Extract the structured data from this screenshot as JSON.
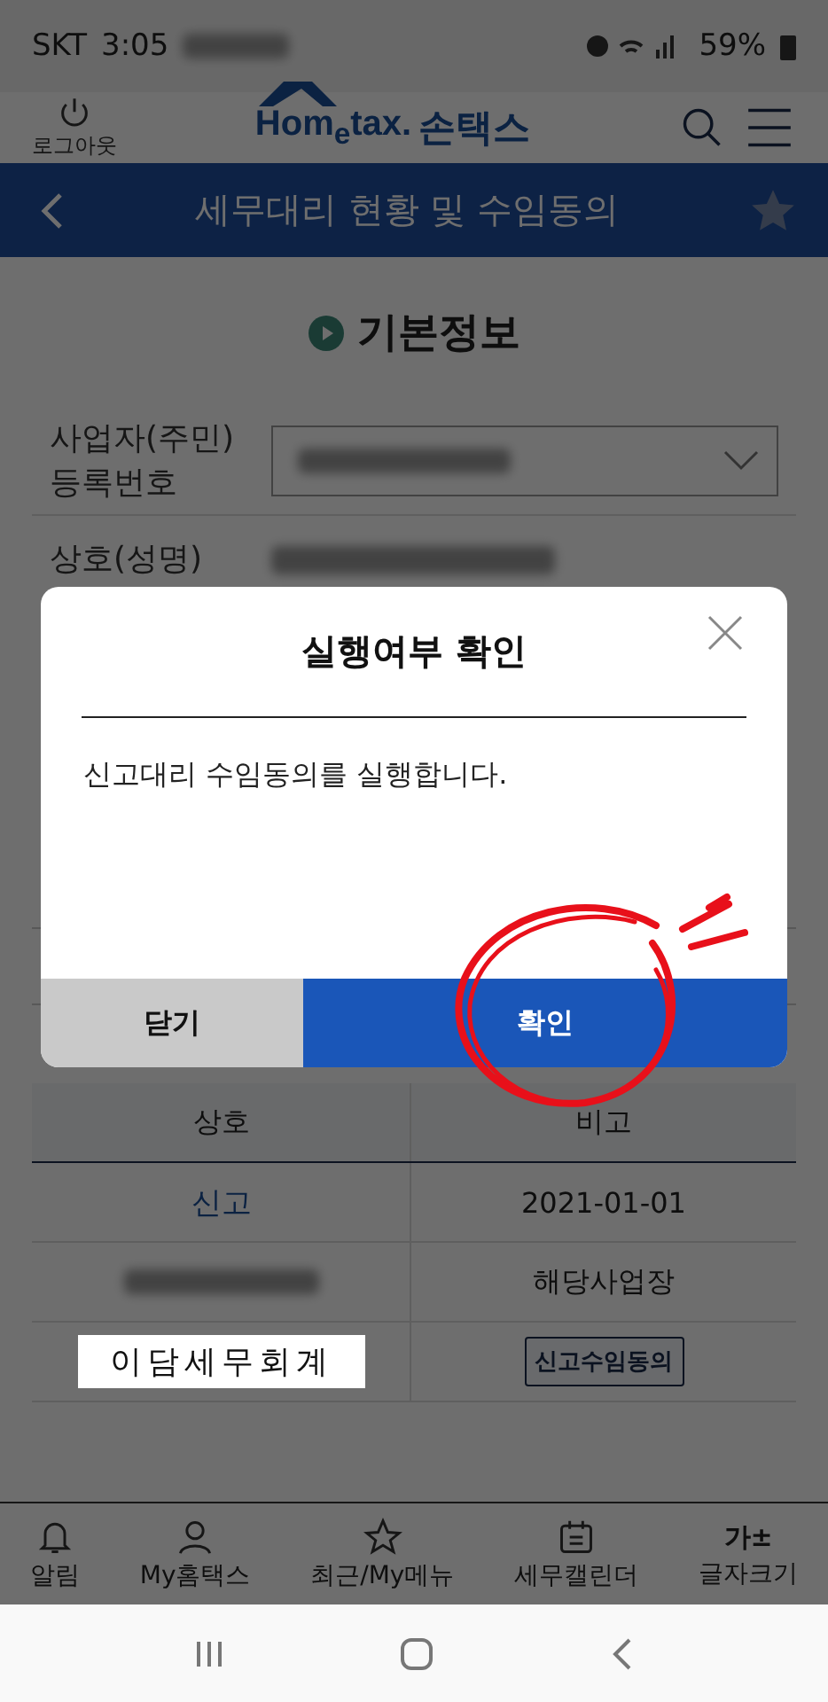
{
  "status_bar": {
    "carrier": "SKT",
    "time": "3:05",
    "battery": "59%"
  },
  "header": {
    "logout_label": "로그아웃",
    "logo": "Hom$_{e}$tax.",
    "logo_korean": "손택스"
  },
  "title_bar": {
    "title": "세무대리 현황 및 수임동의"
  },
  "section": {
    "title": "기본정보"
  },
  "form": [
    {
      "label": "사업자(주민) 등록번호",
      "kind": "select"
    },
    {
      "label": "상호(성명)",
      "kind": "text"
    }
  ],
  "table": {
    "columns": [
      "상호",
      "비고"
    ],
    "rows": [
      {
        "kind": "status",
        "col_1": "신고",
        "col_2": "2021-01-01"
      },
      {
        "kind": "redacted",
        "col_2": "해당사업장"
      },
      {
        "kind": "action",
        "col_1": "이담세무회계",
        "col_2": "신고수임동의"
      }
    ]
  },
  "dialog": {
    "title": "실행여부 확인",
    "message": "신고대리 수임동의를 실행합니다.",
    "buttons": [
      {
        "label": "닫기",
        "kind": "secondary"
      },
      {
        "label": "확인",
        "kind": "primary"
      }
    ]
  },
  "bottom_nav": [
    {
      "label": "알림",
      "kind": "bell"
    },
    {
      "label": "My홈택스",
      "kind": "user"
    },
    {
      "label": "최근/My메뉴",
      "kind": "star"
    },
    {
      "label": "세무캘린더",
      "kind": "calendar"
    },
    {
      "label": "글자크기",
      "kind": "text",
      "glyph": "가±"
    }
  ]
}
